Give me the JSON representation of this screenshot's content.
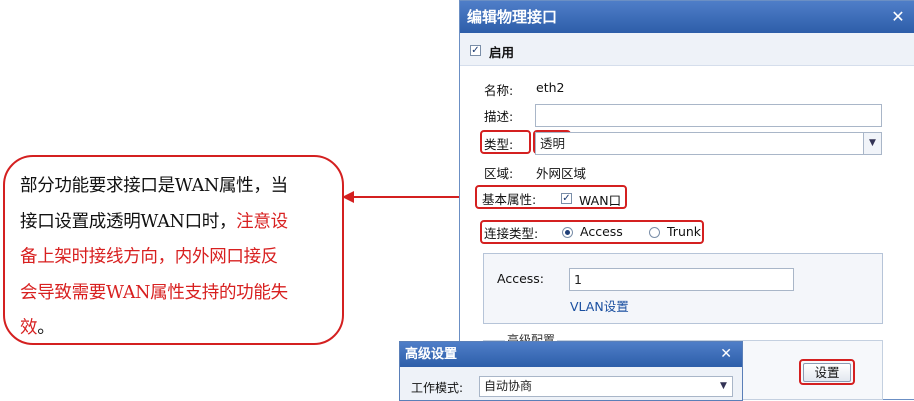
{
  "callout": {
    "line1": "部分功能要求接口是WAN属性，当",
    "line2_black": "接口设置成透明WAN口时，",
    "line2_red": "注意设",
    "line3": "备上架时接线方向，内外网口接反",
    "line4": "会导致需要WAN属性支持的功能失",
    "line5_red": "效",
    "line5_end": "。"
  },
  "dialog": {
    "title": "编辑物理接口",
    "close": "✕",
    "enable_label": "启用",
    "enable_checked": true,
    "name_label": "名称:",
    "name_value": "eth2",
    "desc_label": "描述:",
    "desc_value": "",
    "type_label": "类型:",
    "type_value": "透明",
    "zone_label": "区域:",
    "zone_value": "外网区域",
    "basic_attr_label": "基本属性:",
    "wan_label": "WAN口",
    "wan_checked": true,
    "conn_type_label": "连接类型:",
    "conn_options": [
      "Access",
      "Trunk"
    ],
    "conn_selected": "Access",
    "access_label": "Access:",
    "access_value": "1",
    "vlan_link": "VLAN设置",
    "adv_section_label": "高级配置",
    "settings_button": "设置"
  },
  "advanced": {
    "title": "高级设置",
    "close": "✕",
    "work_mode_label": "工作模式:",
    "work_mode_value": "自动协商"
  },
  "colors": {
    "accent": "#d42020",
    "title_bar": "#3d6db8",
    "link": "#1a4fa0"
  }
}
